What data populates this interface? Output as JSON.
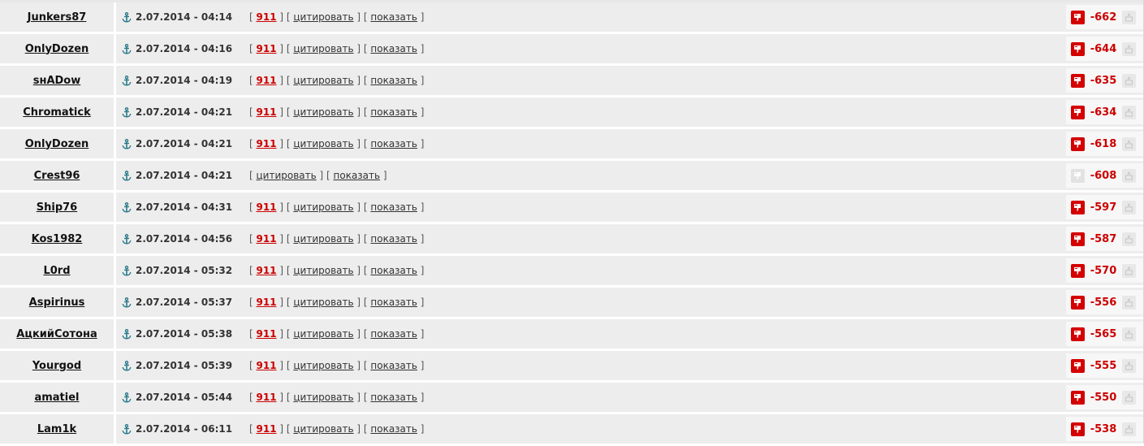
{
  "labels": {
    "num": "911",
    "quote": "цитировать",
    "show": "показать"
  },
  "icons": {
    "anchor": "anchor-icon",
    "down": "thumbs-down-icon",
    "up": "thumbs-up-icon"
  },
  "colors": {
    "accent": "#cc0000",
    "row_bg": "#ededed",
    "anchor": "#2a7a8a"
  },
  "comments": [
    {
      "user": "Junkers87",
      "date": "2.07.2014 - 04:14",
      "has_num": true,
      "down_active": true,
      "score": "-662"
    },
    {
      "user": "OnlyDozen",
      "date": "2.07.2014 - 04:16",
      "has_num": true,
      "down_active": true,
      "score": "-644"
    },
    {
      "user": "sнADow",
      "date": "2.07.2014 - 04:19",
      "has_num": true,
      "down_active": true,
      "score": "-635"
    },
    {
      "user": "Chromatick",
      "date": "2.07.2014 - 04:21",
      "has_num": true,
      "down_active": true,
      "score": "-634"
    },
    {
      "user": "OnlyDozen",
      "date": "2.07.2014 - 04:21",
      "has_num": true,
      "down_active": true,
      "score": "-618"
    },
    {
      "user": "Crest96",
      "date": "2.07.2014 - 04:21",
      "has_num": false,
      "down_active": false,
      "score": "-608"
    },
    {
      "user": "Ship76",
      "date": "2.07.2014 - 04:31",
      "has_num": true,
      "down_active": true,
      "score": "-597"
    },
    {
      "user": "Kos1982",
      "date": "2.07.2014 - 04:56",
      "has_num": true,
      "down_active": true,
      "score": "-587"
    },
    {
      "user": "L0rd",
      "date": "2.07.2014 - 05:32",
      "has_num": true,
      "down_active": true,
      "score": "-570"
    },
    {
      "user": "Aspirinus",
      "date": "2.07.2014 - 05:37",
      "has_num": true,
      "down_active": true,
      "score": "-556"
    },
    {
      "user": "АцкийСотона",
      "date": "2.07.2014 - 05:38",
      "has_num": true,
      "down_active": true,
      "score": "-565"
    },
    {
      "user": "Yourgod",
      "date": "2.07.2014 - 05:39",
      "has_num": true,
      "down_active": true,
      "score": "-555"
    },
    {
      "user": "amatiel",
      "date": "2.07.2014 - 05:44",
      "has_num": true,
      "down_active": true,
      "score": "-550"
    },
    {
      "user": "Lam1k",
      "date": "2.07.2014 - 06:11",
      "has_num": true,
      "down_active": true,
      "score": "-538"
    }
  ]
}
